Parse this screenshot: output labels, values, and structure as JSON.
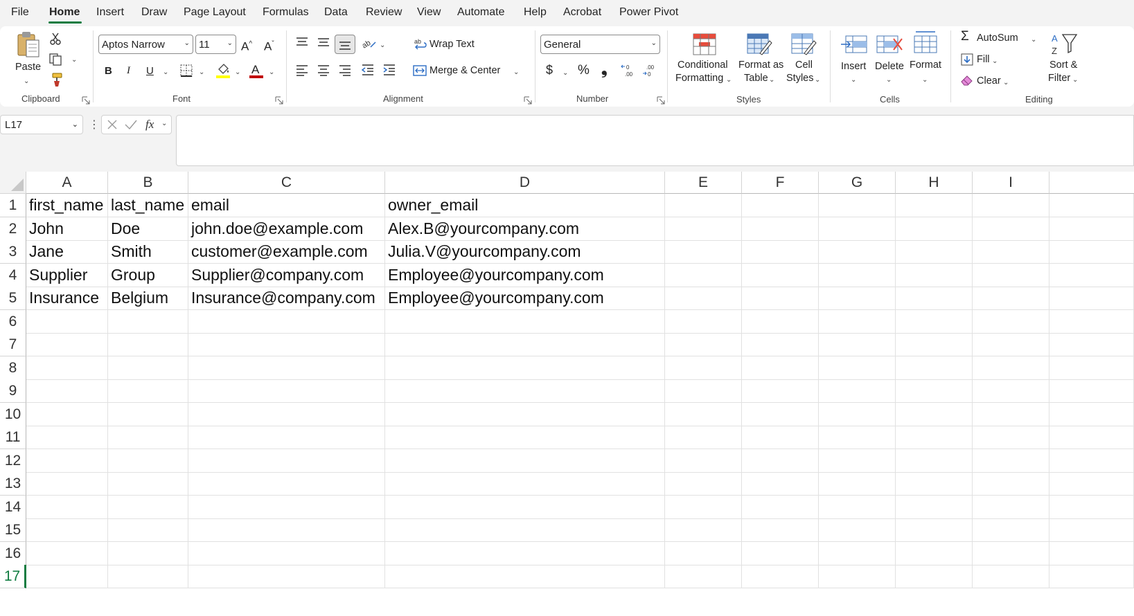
{
  "menu": {
    "tabs": [
      "File",
      "Home",
      "Insert",
      "Draw",
      "Page Layout",
      "Formulas",
      "Data",
      "Review",
      "View",
      "Automate",
      "Help",
      "Acrobat",
      "Power Pivot"
    ],
    "active": "Home"
  },
  "ribbon": {
    "clipboard": {
      "group_label": "Clipboard",
      "paste_label": "Paste"
    },
    "font": {
      "group_label": "Font",
      "font_name": "Aptos Narrow",
      "font_size": "11",
      "bold": "B",
      "italic": "I",
      "underline": "U",
      "font_color_glyph": "A"
    },
    "alignment": {
      "group_label": "Alignment",
      "wrap_text": "Wrap Text",
      "merge_center": "Merge & Center"
    },
    "number": {
      "group_label": "Number",
      "format": "General",
      "currency": "$",
      "percent": "%",
      "comma": "❟"
    },
    "styles": {
      "group_label": "Styles",
      "conditional_1": "Conditional",
      "conditional_2": "Formatting",
      "format_table_1": "Format as",
      "format_table_2": "Table",
      "cell_styles_1": "Cell",
      "cell_styles_2": "Styles"
    },
    "cells": {
      "group_label": "Cells",
      "insert": "Insert",
      "delete": "Delete",
      "format": "Format"
    },
    "editing": {
      "group_label": "Editing",
      "autosum": "AutoSum",
      "fill": "Fill",
      "clear": "Clear",
      "sort_1": "Sort &",
      "sort_2": "Filter"
    }
  },
  "formula_bar": {
    "name_box": "L17",
    "fx": "fx",
    "formula": ""
  },
  "sheet": {
    "columns": [
      "A",
      "B",
      "C",
      "D",
      "E",
      "F",
      "G",
      "H",
      "I"
    ],
    "row_numbers": [
      "1",
      "2",
      "3",
      "4",
      "5",
      "6",
      "7",
      "8",
      "9",
      "10",
      "11",
      "12",
      "13",
      "14",
      "15",
      "16",
      "17"
    ],
    "selected_row": "17",
    "rows": [
      [
        "first_name",
        "last_name",
        "email",
        "owner_email"
      ],
      [
        "John",
        "Doe",
        "john.doe@example.com",
        "Alex.B@yourcompany.com"
      ],
      [
        "Jane",
        "Smith",
        "customer@example.com",
        "Julia.V@yourcompany.com"
      ],
      [
        "Supplier",
        "Group",
        "Supplier@company.com",
        "Employee@yourcompany.com"
      ],
      [
        "Insurance",
        "Belgium",
        "Insurance@company.com",
        "Employee@yourcompany.com"
      ]
    ]
  },
  "colors": {
    "accent": "#107c41",
    "ribbon_bg": "#f3f3f3",
    "grid_line": "#e1e1e1"
  }
}
